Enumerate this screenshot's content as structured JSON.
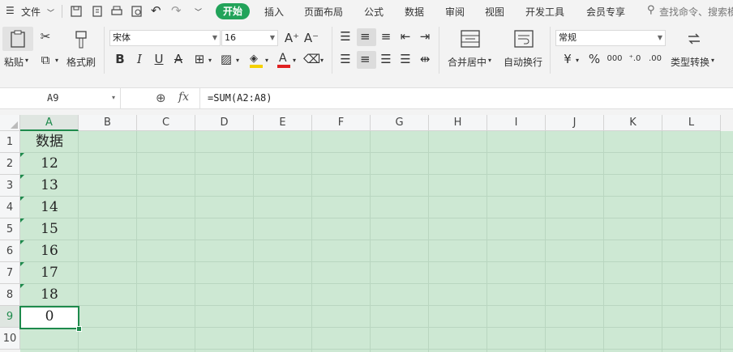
{
  "menubar": {
    "file": "文件",
    "tabs": [
      "开始",
      "插入",
      "页面布局",
      "公式",
      "数据",
      "审阅",
      "视图",
      "开发工具",
      "会员专享"
    ],
    "search_placeholder": "查找命令、搜索模"
  },
  "ribbon": {
    "paste_label": "粘贴",
    "format_painter_label": "格式刷",
    "font_name": "宋体",
    "font_size": "16",
    "merge_label": "合并居中",
    "wrap_label": "自动换行",
    "number_format": "常规",
    "convert_label": "类型转换",
    "percent_glyph": "%",
    "currency_glyph": "¥"
  },
  "formula_bar": {
    "name_box": "A9",
    "fx": "fx",
    "formula": "=SUM(A2:A8)"
  },
  "sheet": {
    "columns": [
      "A",
      "B",
      "C",
      "D",
      "E",
      "F",
      "G",
      "H",
      "I",
      "J",
      "K",
      "L"
    ],
    "rows": [
      "1",
      "2",
      "3",
      "4",
      "5",
      "6",
      "7",
      "8",
      "9",
      "10"
    ],
    "column_a": [
      "数据",
      "12",
      "13",
      "14",
      "15",
      "16",
      "17",
      "18",
      "0"
    ],
    "selected_cell": "A9",
    "cell_fill_color": "#cde8d3",
    "selection_color": "#1e8a4c"
  }
}
